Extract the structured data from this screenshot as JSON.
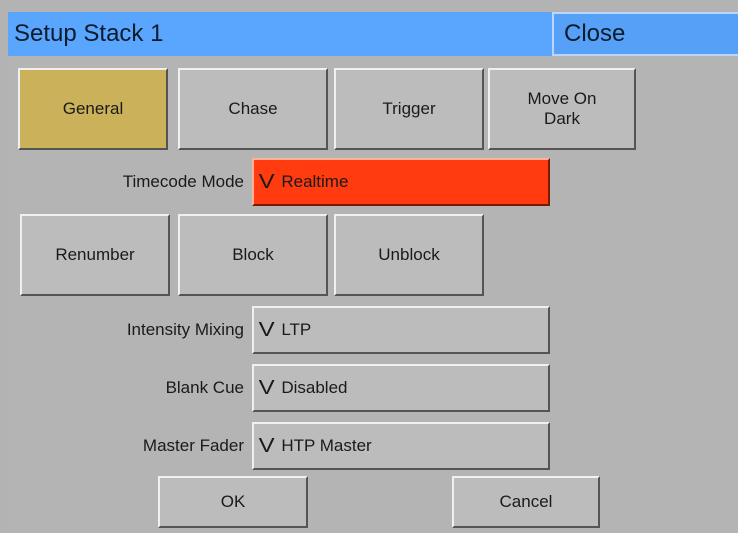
{
  "window": {
    "title": "Setup Stack 1",
    "close_label": "Close"
  },
  "tabs": [
    {
      "label": "General",
      "active": true
    },
    {
      "label": "Chase"
    },
    {
      "label": "Trigger"
    },
    {
      "label": "Move On Dark"
    }
  ],
  "timecode": {
    "label": "Timecode Mode",
    "value": "Realtime",
    "chevron": "V"
  },
  "actions": [
    {
      "label": "Renumber"
    },
    {
      "label": "Block"
    },
    {
      "label": "Unblock"
    }
  ],
  "settings": {
    "intensity_mixing": {
      "label": "Intensity Mixing",
      "value": "LTP",
      "chevron": "V"
    },
    "blank_cue": {
      "label": "Blank Cue",
      "value": "Disabled",
      "chevron": "V"
    },
    "master_fader": {
      "label": "Master Fader",
      "value": "HTP Master",
      "chevron": "V"
    }
  },
  "footer": {
    "ok_label": "OK",
    "cancel_label": "Cancel"
  },
  "colors": {
    "titlebar": "#5aa6ff",
    "panel": "#b4b4b4",
    "active_tab": "#cbb25a",
    "alert_dropdown": "#ff3b0f"
  }
}
